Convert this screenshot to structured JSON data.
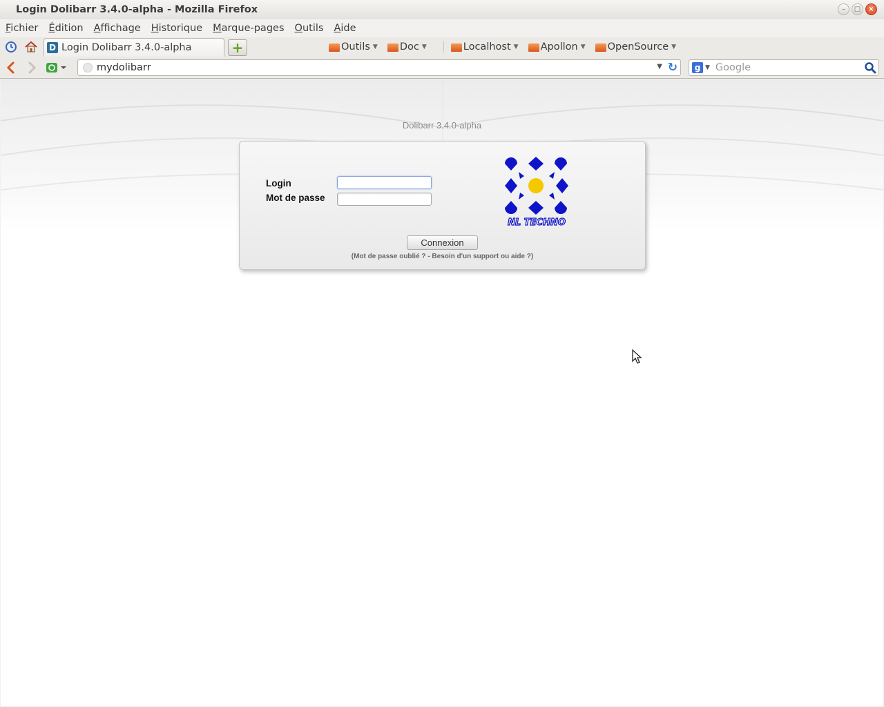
{
  "window": {
    "title": "Login Dolibarr 3.4.0-alpha - Mozilla Firefox"
  },
  "menu": {
    "items": [
      {
        "first": "F",
        "rest": "ichier"
      },
      {
        "first": "É",
        "rest": "dition"
      },
      {
        "first": "A",
        "rest": "ffichage"
      },
      {
        "first": "H",
        "rest": "istorique"
      },
      {
        "first": "M",
        "rest": "arque-pages"
      },
      {
        "first": "O",
        "rest": "utils"
      },
      {
        "first": "A",
        "rest": "ide"
      }
    ]
  },
  "tabs": {
    "active_label": "Login Dolibarr 3.4.0-alpha",
    "favicon_letter": "D"
  },
  "bookmarks": [
    "Outils",
    "Doc",
    "Localhost",
    "Apollon",
    "OpenSource"
  ],
  "navbar": {
    "url": "mydolibarr",
    "search_engine_letter": "g",
    "search_placeholder": "Google"
  },
  "page": {
    "version": "Dolibarr 3.4.0-alpha",
    "login_label": "Login",
    "password_label": "Mot de passe",
    "login_value": "",
    "password_value": "",
    "submit_label": "Connexion",
    "help_text": "(Mot de passe oublié ? - Besoin d'un support ou aide ?)",
    "logo_text": "NL TECHNO"
  },
  "colors": {
    "logo_blue": "#0f14c8",
    "logo_yellow": "#f5c800",
    "folder_orange": "#e36a28"
  }
}
